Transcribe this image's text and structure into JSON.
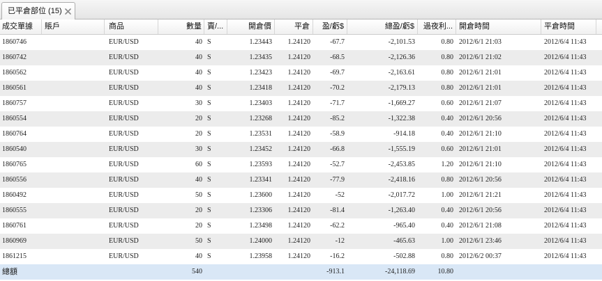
{
  "tab": {
    "title": "已平倉部位 (15)",
    "close_icon": "close-icon"
  },
  "table": {
    "columns": {
      "ticket": "成交單據",
      "account": "賬戶",
      "symbol": "商品",
      "quantity": "數量",
      "side": "賣/...",
      "open_price": "開倉價",
      "close_price": "平倉",
      "pnl": "盈/虧$",
      "total_pnl": "總盈/虧$",
      "overnight": "過夜利...",
      "open_time": "開倉時間",
      "close_time": "平倉時間"
    },
    "rows": [
      {
        "ticket": "1860746",
        "symbol": "EUR/USD",
        "quantity": "40",
        "side": "S",
        "open_price": "1.23443",
        "close_price": "1.24120",
        "pnl": "-67.7",
        "total_pnl": "-2,101.53",
        "overnight": "0.80",
        "open_time": "2012/6/1 21:03",
        "close_time": "2012/6/4 11:43"
      },
      {
        "ticket": "1860742",
        "symbol": "EUR/USD",
        "quantity": "40",
        "side": "S",
        "open_price": "1.23435",
        "close_price": "1.24120",
        "pnl": "-68.5",
        "total_pnl": "-2,126.36",
        "overnight": "0.80",
        "open_time": "2012/6/1 21:02",
        "close_time": "2012/6/4 11:43"
      },
      {
        "ticket": "1860562",
        "symbol": "EUR/USD",
        "quantity": "40",
        "side": "S",
        "open_price": "1.23423",
        "close_price": "1.24120",
        "pnl": "-69.7",
        "total_pnl": "-2,163.61",
        "overnight": "0.80",
        "open_time": "2012/6/1 21:01",
        "close_time": "2012/6/4 11:43"
      },
      {
        "ticket": "1860561",
        "symbol": "EUR/USD",
        "quantity": "40",
        "side": "S",
        "open_price": "1.23418",
        "close_price": "1.24120",
        "pnl": "-70.2",
        "total_pnl": "-2,179.13",
        "overnight": "0.80",
        "open_time": "2012/6/1 21:01",
        "close_time": "2012/6/4 11:43"
      },
      {
        "ticket": "1860757",
        "symbol": "EUR/USD",
        "quantity": "30",
        "side": "S",
        "open_price": "1.23403",
        "close_price": "1.24120",
        "pnl": "-71.7",
        "total_pnl": "-1,669.27",
        "overnight": "0.60",
        "open_time": "2012/6/1 21:07",
        "close_time": "2012/6/4 11:43"
      },
      {
        "ticket": "1860554",
        "symbol": "EUR/USD",
        "quantity": "20",
        "side": "S",
        "open_price": "1.23268",
        "close_price": "1.24120",
        "pnl": "-85.2",
        "total_pnl": "-1,322.38",
        "overnight": "0.40",
        "open_time": "2012/6/1 20:56",
        "close_time": "2012/6/4 11:43"
      },
      {
        "ticket": "1860764",
        "symbol": "EUR/USD",
        "quantity": "20",
        "side": "S",
        "open_price": "1.23531",
        "close_price": "1.24120",
        "pnl": "-58.9",
        "total_pnl": "-914.18",
        "overnight": "0.40",
        "open_time": "2012/6/1 21:10",
        "close_time": "2012/6/4 11:43"
      },
      {
        "ticket": "1860540",
        "symbol": "EUR/USD",
        "quantity": "30",
        "side": "S",
        "open_price": "1.23452",
        "close_price": "1.24120",
        "pnl": "-66.8",
        "total_pnl": "-1,555.19",
        "overnight": "0.60",
        "open_time": "2012/6/1 21:01",
        "close_time": "2012/6/4 11:43"
      },
      {
        "ticket": "1860765",
        "symbol": "EUR/USD",
        "quantity": "60",
        "side": "S",
        "open_price": "1.23593",
        "close_price": "1.24120",
        "pnl": "-52.7",
        "total_pnl": "-2,453.85",
        "overnight": "1.20",
        "open_time": "2012/6/1 21:10",
        "close_time": "2012/6/4 11:43"
      },
      {
        "ticket": "1860556",
        "symbol": "EUR/USD",
        "quantity": "40",
        "side": "S",
        "open_price": "1.23341",
        "close_price": "1.24120",
        "pnl": "-77.9",
        "total_pnl": "-2,418.16",
        "overnight": "0.80",
        "open_time": "2012/6/1 20:56",
        "close_time": "2012/6/4 11:43"
      },
      {
        "ticket": "1860492",
        "symbol": "EUR/USD",
        "quantity": "50",
        "side": "S",
        "open_price": "1.23600",
        "close_price": "1.24120",
        "pnl": "-52",
        "total_pnl": "-2,017.72",
        "overnight": "1.00",
        "open_time": "2012/6/1 21:21",
        "close_time": "2012/6/4 11:43"
      },
      {
        "ticket": "1860555",
        "symbol": "EUR/USD",
        "quantity": "20",
        "side": "S",
        "open_price": "1.23306",
        "close_price": "1.24120",
        "pnl": "-81.4",
        "total_pnl": "-1,263.40",
        "overnight": "0.40",
        "open_time": "2012/6/1 20:56",
        "close_time": "2012/6/4 11:43"
      },
      {
        "ticket": "1860761",
        "symbol": "EUR/USD",
        "quantity": "20",
        "side": "S",
        "open_price": "1.23498",
        "close_price": "1.24120",
        "pnl": "-62.2",
        "total_pnl": "-965.40",
        "overnight": "0.40",
        "open_time": "2012/6/1 21:08",
        "close_time": "2012/6/4 11:43"
      },
      {
        "ticket": "1860969",
        "symbol": "EUR/USD",
        "quantity": "50",
        "side": "S",
        "open_price": "1.24000",
        "close_price": "1.24120",
        "pnl": "-12",
        "total_pnl": "-465.63",
        "overnight": "1.00",
        "open_time": "2012/6/1 23:46",
        "close_time": "2012/6/4 11:43"
      },
      {
        "ticket": "1861215",
        "symbol": "EUR/USD",
        "quantity": "40",
        "side": "S",
        "open_price": "1.23958",
        "close_price": "1.24120",
        "pnl": "-16.2",
        "total_pnl": "-502.88",
        "overnight": "0.80",
        "open_time": "2012/6/2 00:37",
        "close_time": "2012/6/4 11:43"
      }
    ],
    "total": {
      "label": "總額",
      "quantity": "540",
      "pnl": "-913.1",
      "total_pnl": "-24,118.69",
      "overnight": "10.80"
    }
  },
  "colors": {
    "row_alt": "#ececec",
    "total_row": "#d9e7f6",
    "header_bg": "#f0f0f0",
    "tab_bar": "#e5e5e5"
  }
}
